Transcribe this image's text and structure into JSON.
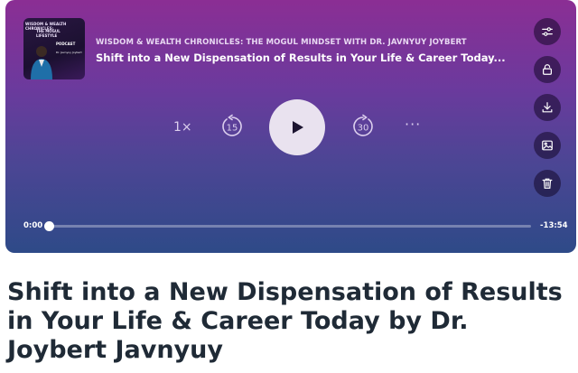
{
  "player": {
    "cover": {
      "line1": "WISDOM & WEALTH CHRONICLES:",
      "line2": "THE MOGUL LIFESTYLE",
      "line3": "PODCAST",
      "line4": "Dr. Javnyuy Joybert"
    },
    "show_title": "WISDOM & WEALTH CHRONICLES: THE MOGUL MINDSET WITH DR. JAVNYUY JOYBERT",
    "episode_title": "Shift into a New Dispensation of Results in Your Life & Career Today...",
    "speed_label": "1×",
    "skip_back_seconds": "15",
    "skip_forward_seconds": "30",
    "more_label": "···",
    "time_current": "0:00",
    "time_remaining": "-13:54",
    "progress": 0,
    "side_actions": [
      {
        "icon": "settings-sliders-icon"
      },
      {
        "icon": "lock-icon"
      },
      {
        "icon": "download-icon"
      },
      {
        "icon": "image-icon"
      },
      {
        "icon": "trash-icon"
      }
    ],
    "colors": {
      "gradient_top": "#8b2e94",
      "gradient_bottom": "#2e4a88",
      "play_button": "#e9e2ef"
    }
  },
  "page": {
    "heading": "Shift into a New Dispensation of Results in Your Life & Career Today by Dr. Joybert Javnyuy"
  }
}
